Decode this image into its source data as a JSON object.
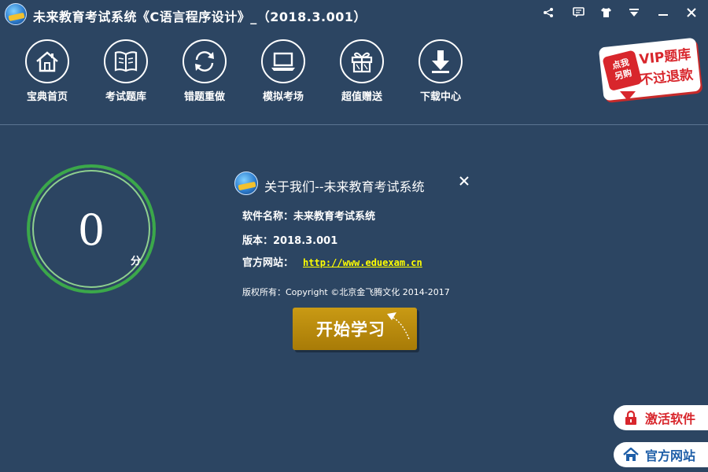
{
  "window": {
    "title": "未来教育考试系统《C语言程序设计》_（2018.3.001）"
  },
  "window_controls": [
    "share-icon",
    "message-icon",
    "shirt-icon",
    "dropdown-icon",
    "minimize-icon",
    "close-icon"
  ],
  "toolbar": {
    "items": [
      {
        "label": "宝典首页",
        "icon": "home-icon"
      },
      {
        "label": "考试题库",
        "icon": "book-icon"
      },
      {
        "label": "错题重做",
        "icon": "refresh-icon"
      },
      {
        "label": "模拟考场",
        "icon": "laptop-icon"
      },
      {
        "label": "超值赠送",
        "icon": "gift-icon"
      },
      {
        "label": "下载中心",
        "icon": "download-icon"
      }
    ]
  },
  "vip_badge": {
    "pill_line1": "点我",
    "pill_line2": "另购",
    "main": "VIP题库",
    "sub": "不过退款"
  },
  "score": {
    "value": "0",
    "unit": "分",
    "ring_color": "#3ba84a"
  },
  "about": {
    "title": "关于我们--未来教育考试系统",
    "software_name_label": "软件名称：",
    "software_name": "未来教育考试系统",
    "version_label": "版本：",
    "version": "2018.3.001",
    "website_label": "官方网站：",
    "website": "http://www.eduexam.cn",
    "copyright": "版权所有：Copyright ©北京金飞腾文化 2014-2017"
  },
  "start_button": {
    "label": "开始学习",
    "color": "#b8890d"
  },
  "side_buttons": {
    "activate": {
      "label": "激活软件",
      "color": "#d8262c",
      "icon": "lock-icon"
    },
    "website": {
      "label": "官方网站",
      "color": "#1f5fa8",
      "icon": "home-icon"
    }
  },
  "colors": {
    "background": "#2c4562",
    "link": "#ffff00"
  }
}
